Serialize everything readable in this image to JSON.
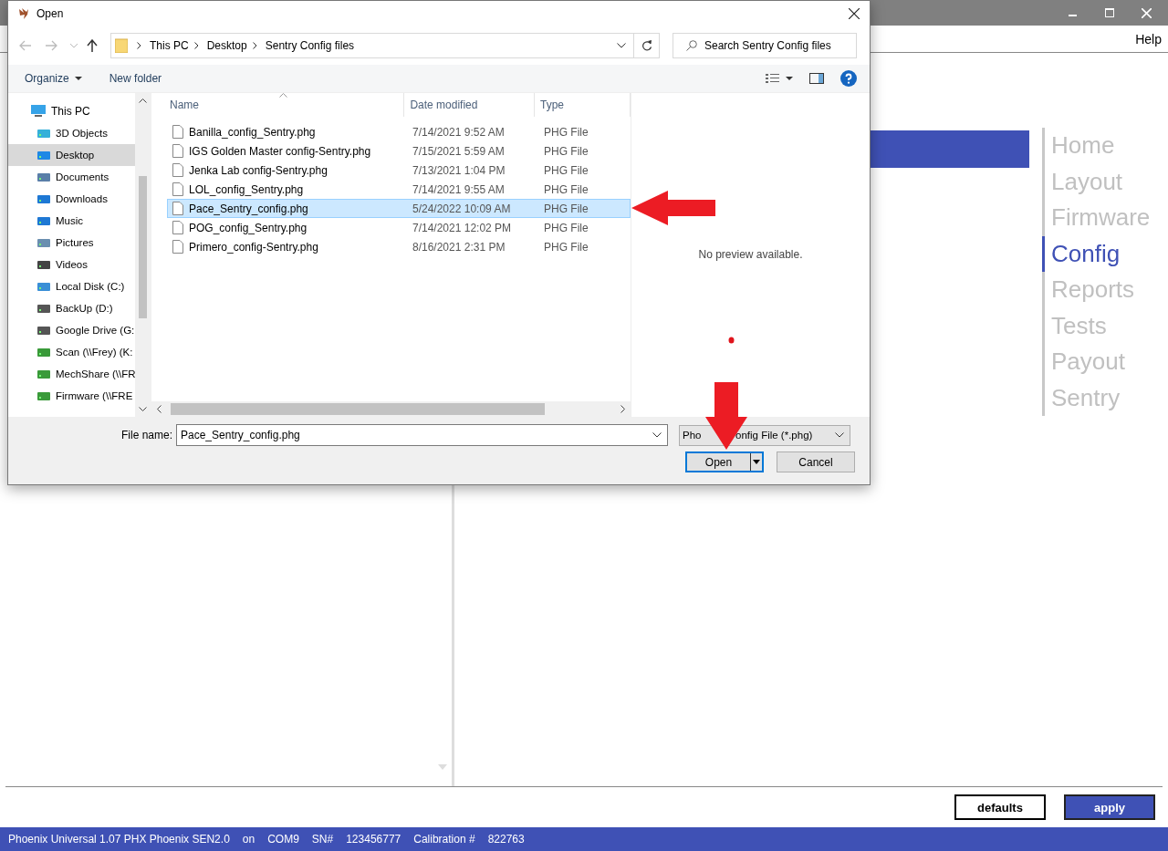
{
  "app": {
    "menu": [
      "Help"
    ],
    "nav": [
      {
        "label": "Home",
        "selected": false
      },
      {
        "label": "Layout",
        "selected": false
      },
      {
        "label": "Firmware",
        "selected": false
      },
      {
        "label": "Config",
        "selected": true
      },
      {
        "label": "Reports",
        "selected": false
      },
      {
        "label": "Tests",
        "selected": false
      },
      {
        "label": "Payout",
        "selected": false
      },
      {
        "label": "Sentry",
        "selected": false
      }
    ],
    "buttons": [
      "defaults",
      "apply"
    ],
    "status": [
      "Phoenix Universal 1.07 PHX Phoenix SEN2.0",
      "on",
      "COM9",
      "SN#",
      "123456777",
      "Calibration #",
      "822763"
    ]
  },
  "dialog": {
    "title": "Open",
    "breadcrumb": [
      "This PC",
      "Desktop",
      "Sentry Config files"
    ],
    "search": {
      "placeholder": "Search Sentry Config files"
    },
    "toolbar": [
      "Organize",
      "New folder"
    ],
    "nav_items": [
      {
        "label": "This PC",
        "selected": false,
        "children": [
          {
            "label": "3D Objects",
            "selected": false
          },
          {
            "label": "Desktop",
            "selected": true
          },
          {
            "label": "Documents",
            "selected": false
          },
          {
            "label": "Downloads",
            "selected": false
          },
          {
            "label": "Music",
            "selected": false
          },
          {
            "label": "Pictures",
            "selected": false
          },
          {
            "label": "Videos",
            "selected": false
          },
          {
            "label": "Local Disk (C:)",
            "selected": false
          },
          {
            "label": "BackUp (D:)",
            "selected": false
          },
          {
            "label": "Google Drive (G:",
            "selected": false
          },
          {
            "label": "Scan (\\\\Frey) (K:",
            "selected": false
          },
          {
            "label": "MechShare (\\\\FR",
            "selected": false
          },
          {
            "label": "Firmware (\\\\FRE",
            "selected": false
          }
        ]
      }
    ],
    "columns": [
      "Name",
      "Date modified",
      "Type"
    ],
    "files": [
      {
        "name": "Banilla_config_Sentry.phg",
        "date": "7/14/2021 9:52 AM",
        "type": "PHG File",
        "selected": false
      },
      {
        "name": "IGS Golden Master config-Sentry.phg",
        "date": "7/15/2021 5:59 AM",
        "type": "PHG File",
        "selected": false
      },
      {
        "name": "Jenka Lab config-Sentry.phg",
        "date": "7/13/2021 1:04 PM",
        "type": "PHG File",
        "selected": false
      },
      {
        "name": "LOL_config_Sentry.phg",
        "date": "7/14/2021 9:55 AM",
        "type": "PHG File",
        "selected": false
      },
      {
        "name": "Pace_Sentry_config.phg",
        "date": "5/24/2022 10:09 AM",
        "type": "PHG File",
        "selected": true
      },
      {
        "name": "POG_config_Sentry.phg",
        "date": "7/14/2021 12:02 PM",
        "type": "PHG File",
        "selected": false
      },
      {
        "name": "Primero_config-Sentry.phg",
        "date": "8/16/2021 2:31 PM",
        "type": "PHG File",
        "selected": false
      }
    ],
    "preview": "No preview available.",
    "file_name": {
      "label": "File name:",
      "value": "Pace_Sentry_config.phg"
    },
    "file_type": [
      "Pho",
      "onfig File (*.phg)"
    ],
    "buttons": [
      "Open",
      "Cancel"
    ]
  }
}
